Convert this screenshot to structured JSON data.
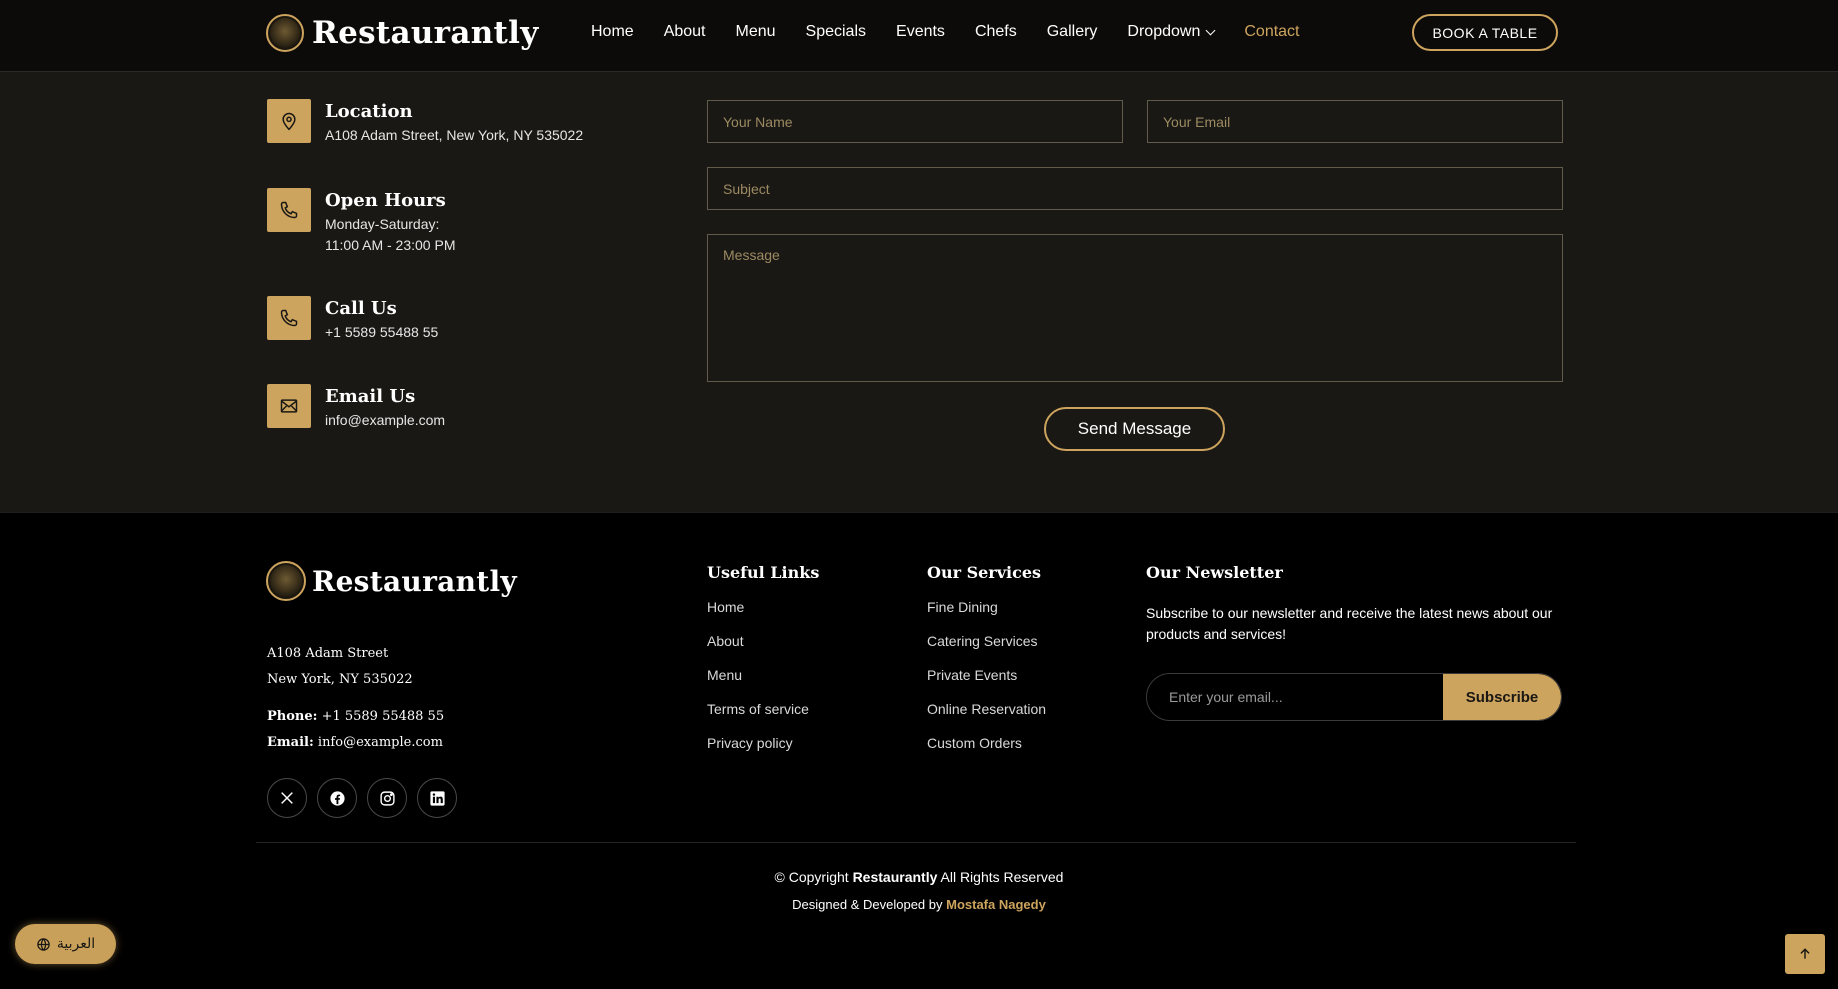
{
  "brand": {
    "name": "Restaurantly",
    "accent_color": "#cda45e"
  },
  "nav": {
    "items": [
      "Home",
      "About",
      "Menu",
      "Specials",
      "Events",
      "Chefs",
      "Gallery",
      "Dropdown",
      "Contact"
    ],
    "active": "Contact",
    "book_label": "BOOK A TABLE"
  },
  "contact_info": {
    "location": {
      "title": "Location",
      "line1": "A108 Adam Street, New York, NY 535022",
      "icon": "map-pin-icon"
    },
    "hours": {
      "title": "Open Hours",
      "line1": "Monday-Saturday:",
      "line2": "11:00 AM - 23:00 PM",
      "icon": "phone-icon"
    },
    "call": {
      "title": "Call Us",
      "line1": "+1 5589 55488 55",
      "icon": "phone-icon"
    },
    "email": {
      "title": "Email Us",
      "line1": "info@example.com",
      "icon": "envelope-icon"
    }
  },
  "form": {
    "name_placeholder": "Your Name",
    "email_placeholder": "Your Email",
    "subject_placeholder": "Subject",
    "message_placeholder": "Message",
    "send_label": "Send Message"
  },
  "footer": {
    "address_line1": "A108 Adam Street",
    "address_line2": "New York, NY 535022",
    "phone_label": "Phone:",
    "phone_value": "+1 5589 55488 55",
    "email_label": "Email:",
    "email_value": "info@example.com",
    "socials": [
      "x-icon",
      "facebook-icon",
      "instagram-icon",
      "linkedin-icon"
    ],
    "useful_links": {
      "title": "Useful Links",
      "items": [
        "Home",
        "About",
        "Menu",
        "Terms of service",
        "Privacy policy"
      ]
    },
    "services": {
      "title": "Our Services",
      "items": [
        "Fine Dining",
        "Catering Services",
        "Private Events",
        "Online Reservation",
        "Custom Orders"
      ]
    },
    "newsletter": {
      "title": "Our Newsletter",
      "text": "Subscribe to our newsletter and receive the latest news about our products and services!",
      "placeholder": "Enter your email...",
      "button": "Subscribe"
    },
    "copyright_prefix": "© Copyright",
    "copyright_brand": "Restaurantly",
    "copyright_suffix": "All Rights Reserved",
    "credit_prefix": "Designed & Developed by",
    "credit_author": "Mostafa Nagedy"
  },
  "language_toggle": {
    "label": "العربية",
    "icon": "globe-icon"
  },
  "scroll_top": {
    "icon": "arrow-up-icon"
  }
}
